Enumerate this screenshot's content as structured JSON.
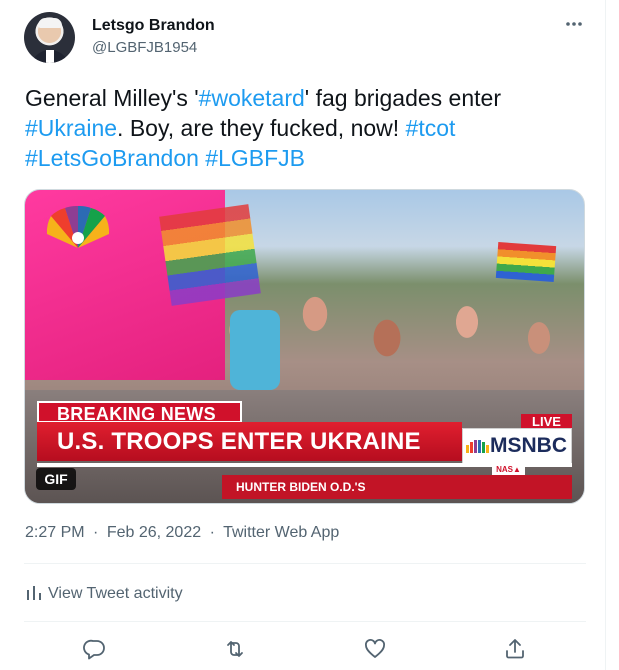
{
  "user": {
    "display_name": "Letsgo Brandon",
    "handle": "@LGBFJB1954"
  },
  "more_icon": "more-horizontal-icon",
  "tweet": {
    "segments": [
      {
        "text": "General Milley's '",
        "type": "text"
      },
      {
        "text": "#woketard",
        "type": "hashtag"
      },
      {
        "text": "' fag brigades enter ",
        "type": "text"
      },
      {
        "text": "#Ukraine",
        "type": "hashtag"
      },
      {
        "text": ". Boy, are they fucked, now! ",
        "type": "text"
      },
      {
        "text": "#tcot",
        "type": "hashtag"
      },
      {
        "text": " ",
        "type": "text"
      },
      {
        "text": "#LetsGoBrandon",
        "type": "hashtag"
      },
      {
        "text": " ",
        "type": "text"
      },
      {
        "text": "#LGBFJB",
        "type": "hashtag"
      }
    ]
  },
  "media": {
    "breaking_label": "BREAKING NEWS",
    "headline": "U.S. TROOPS ENTER UKRAINE",
    "network": "MSNBC",
    "live": "LIVE",
    "nas": "NAS▲",
    "ticker": "HUNTER BIDEN O.D.'S",
    "gif_badge": "GIF"
  },
  "meta": {
    "time": "2:27 PM",
    "date": "Feb 26, 2022",
    "source": "Twitter Web App",
    "sep": "·"
  },
  "activity": {
    "label": "View Tweet activity",
    "icon": "bar-chart-icon"
  },
  "actions": [
    {
      "name": "reply",
      "icon": "reply-icon"
    },
    {
      "name": "retweet",
      "icon": "retweet-icon"
    },
    {
      "name": "like",
      "icon": "heart-icon"
    },
    {
      "name": "share",
      "icon": "share-icon"
    }
  ],
  "colors": {
    "accent": "#1d9bf0",
    "secondary_text": "#536471",
    "breaking_red": "#d0112b"
  }
}
